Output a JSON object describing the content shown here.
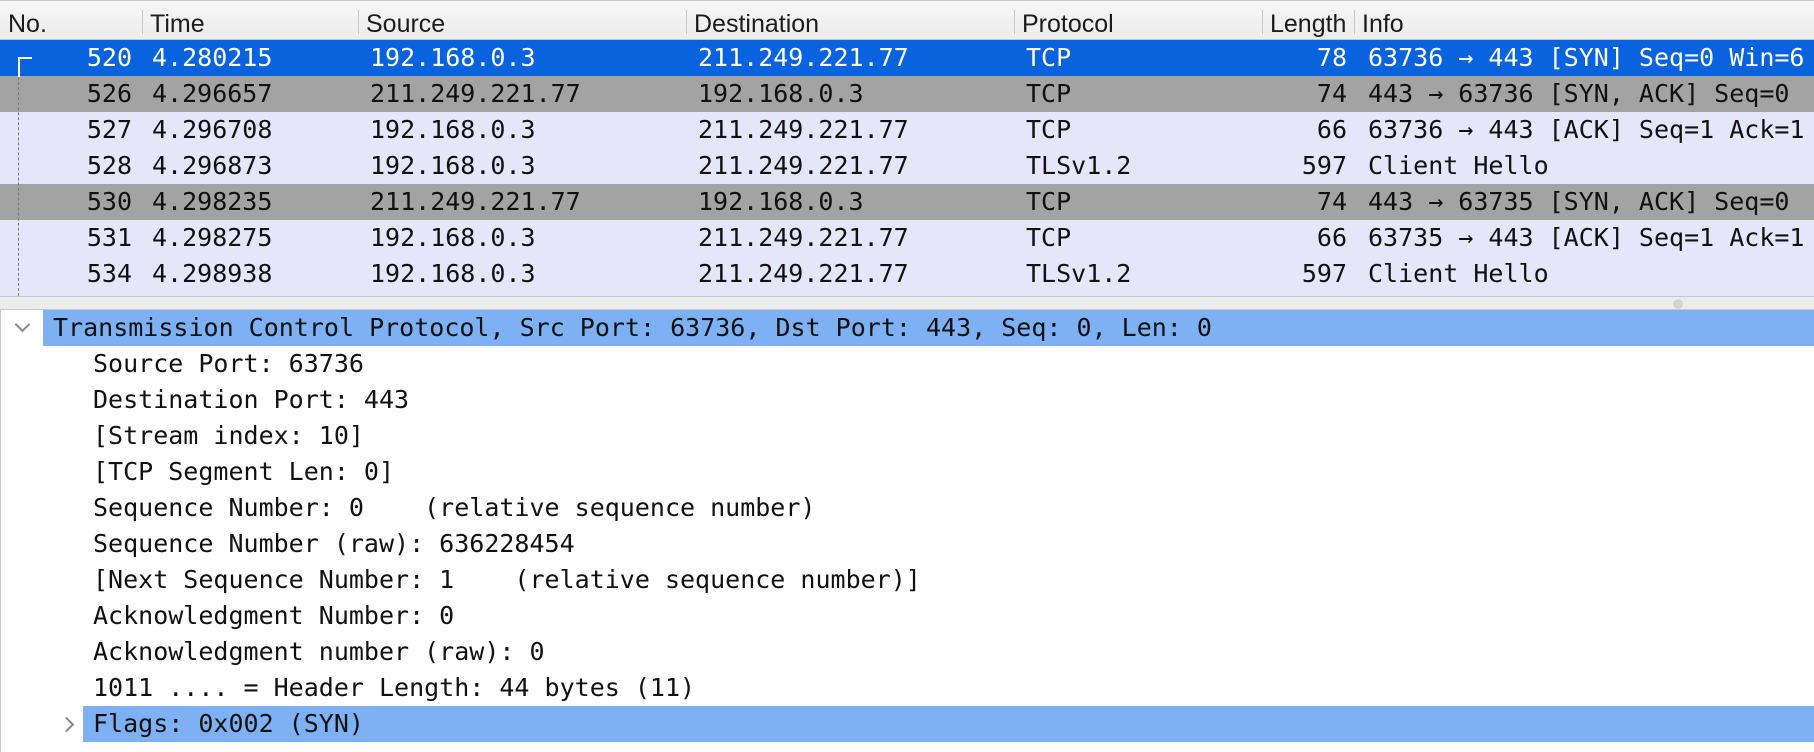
{
  "packet_list": {
    "columns": [
      "No.",
      "Time",
      "Source",
      "Destination",
      "Protocol",
      "Length",
      "Info"
    ],
    "rows": [
      {
        "no": "520",
        "time": "4.280215",
        "source": "192.168.0.3",
        "destination": "211.249.221.77",
        "protocol": "TCP",
        "length": "78",
        "info": "63736 → 443 [SYN] Seq=0 Win=6",
        "style": "selected"
      },
      {
        "no": "526",
        "time": "4.296657",
        "source": "211.249.221.77",
        "destination": "192.168.0.3",
        "protocol": "TCP",
        "length": "74",
        "info": "443 → 63736 [SYN, ACK] Seq=0",
        "style": "gray"
      },
      {
        "no": "527",
        "time": "4.296708",
        "source": "192.168.0.3",
        "destination": "211.249.221.77",
        "protocol": "TCP",
        "length": "66",
        "info": "63736 → 443 [ACK] Seq=1 Ack=1",
        "style": "lav"
      },
      {
        "no": "528",
        "time": "4.296873",
        "source": "192.168.0.3",
        "destination": "211.249.221.77",
        "protocol": "TLSv1.2",
        "length": "597",
        "info": "Client Hello",
        "style": "lav"
      },
      {
        "no": "530",
        "time": "4.298235",
        "source": "211.249.221.77",
        "destination": "192.168.0.3",
        "protocol": "TCP",
        "length": "74",
        "info": "443 → 63735 [SYN, ACK] Seq=0",
        "style": "gray"
      },
      {
        "no": "531",
        "time": "4.298275",
        "source": "192.168.0.3",
        "destination": "211.249.221.77",
        "protocol": "TCP",
        "length": "66",
        "info": "63735 → 443 [ACK] Seq=1 Ack=1",
        "style": "lav"
      },
      {
        "no": "534",
        "time": "4.298938",
        "source": "192.168.0.3",
        "destination": "211.249.221.77",
        "protocol": "TLSv1.2",
        "length": "597",
        "info": "Client Hello",
        "style": "lav"
      }
    ]
  },
  "details": {
    "tcp_header": "Transmission Control Protocol, Src Port: 63736, Dst Port: 443, Seq: 0, Len: 0",
    "fields": [
      "Source Port: 63736",
      "Destination Port: 443",
      "[Stream index: 10]",
      "[TCP Segment Len: 0]",
      "Sequence Number: 0    (relative sequence number)",
      "Sequence Number (raw): 636228454",
      "[Next Sequence Number: 1    (relative sequence number)]",
      "Acknowledgment Number: 0",
      "Acknowledgment number (raw): 0",
      "1011 .... = Header Length: 44 bytes (11)"
    ],
    "flags": "Flags: 0x002 (SYN)"
  },
  "colors": {
    "selected_row": "#0a63de",
    "gray_row": "#a3a3a3",
    "tcp_row": "#e6e6fb",
    "detail_highlight": "#7db1f4"
  }
}
